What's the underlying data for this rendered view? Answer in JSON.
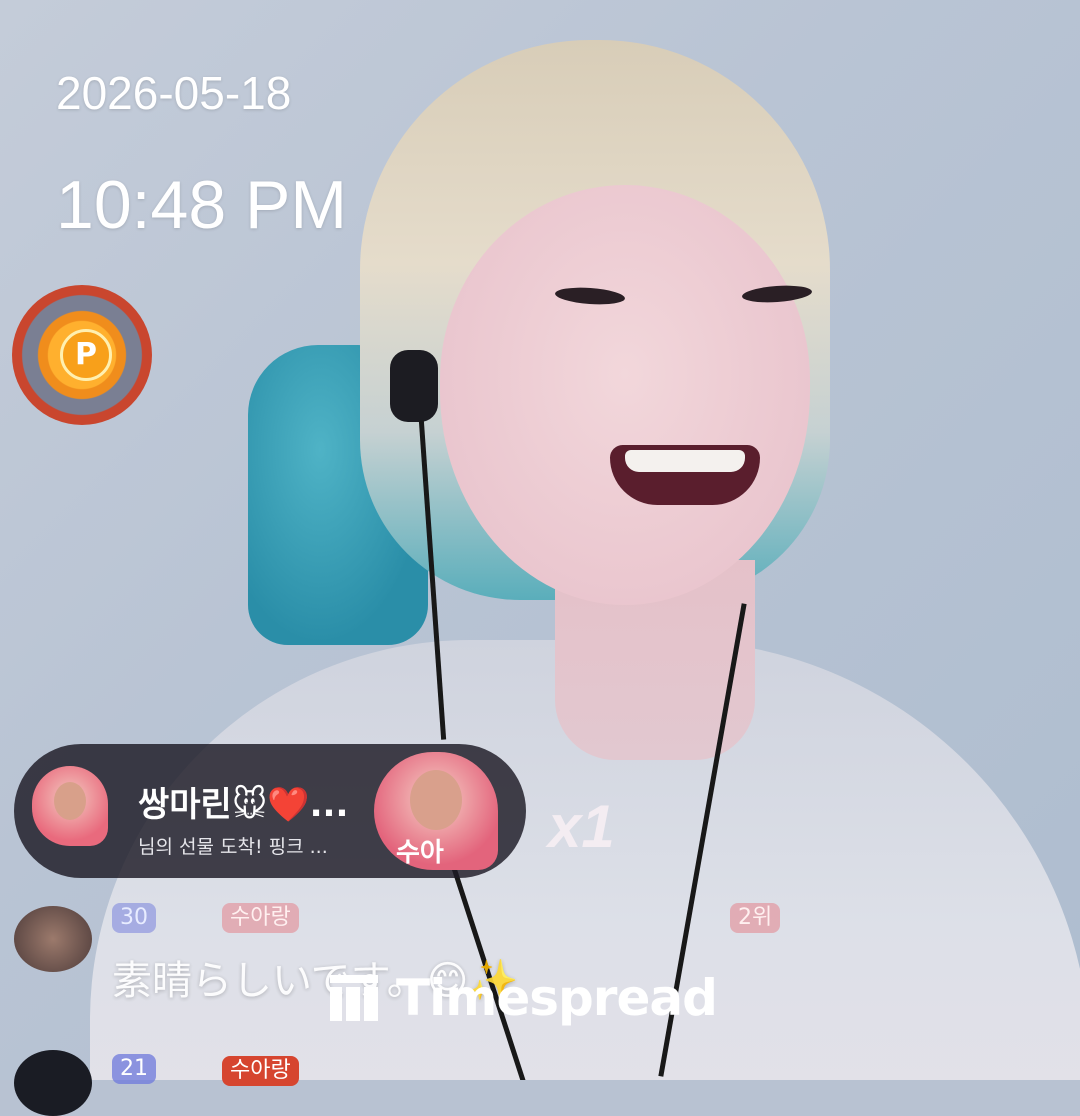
{
  "overlay": {
    "date": "2026-05-18",
    "time": "10:48 PM",
    "points_icon_letter": "P"
  },
  "gift_banner": {
    "sender_name": "쌍마린🐭❤️...",
    "message": "님의 선물 도착! 핑크 ...",
    "gift_label": "수아",
    "multiplier": "x1"
  },
  "chat": {
    "row1": {
      "level_badge": "30",
      "fan_badge": "수아랑",
      "rank_badge": "2위",
      "message": "素晴らしいです。😊✨"
    },
    "row2": {
      "level_badge": "21",
      "fan_badge": "수아랑"
    }
  },
  "watermark": {
    "text": "Timespread"
  },
  "colors": {
    "banner_bg": "#1c1a24",
    "coin_orange": "#f8a01a",
    "coin_ring": "#c9462e",
    "chair_teal": "#2a8ea8"
  }
}
